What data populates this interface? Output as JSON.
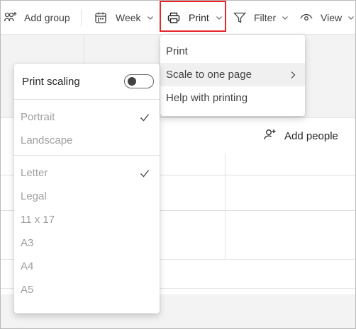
{
  "toolbar": {
    "add_group_label": "Add group",
    "week_label": "Week",
    "print_label": "Print",
    "filter_label": "Filter",
    "view_label": "View"
  },
  "board": {
    "add_people_label": "Add people"
  },
  "print_menu": {
    "items": [
      "Print",
      "Scale to one page",
      "Help with printing"
    ],
    "active_item": "Scale to one page"
  },
  "scale_menu": {
    "toggle_label": "Print scaling",
    "toggle_on": false,
    "orientation": [
      "Portrait",
      "Landscape"
    ],
    "orientation_selected": "Portrait",
    "paper_sizes": [
      "Letter",
      "Legal",
      "11 x 17",
      "A3",
      "A4",
      "A5"
    ],
    "paper_selected": "Letter"
  },
  "colors": {
    "highlight_border": "#e8262a",
    "disabled_text": "#9e9e9e"
  }
}
